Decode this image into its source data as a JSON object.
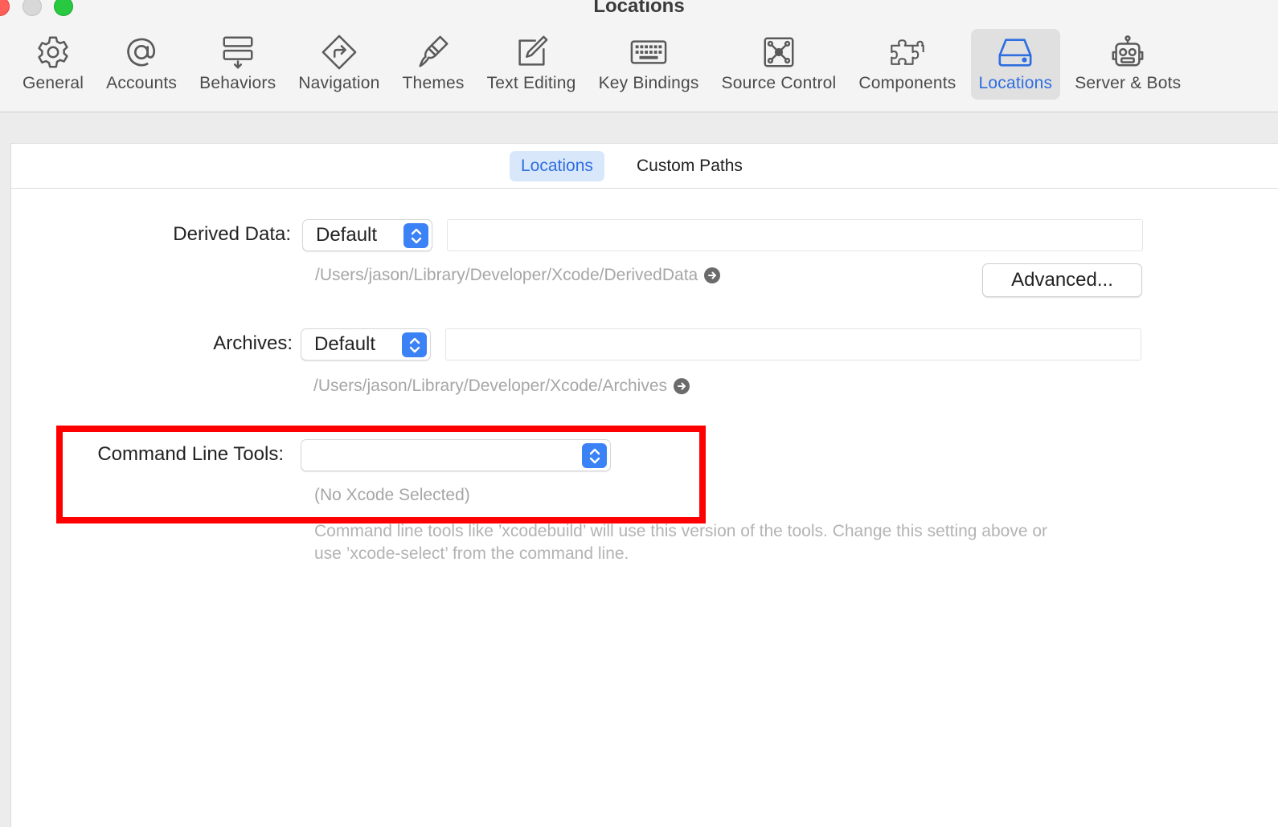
{
  "window": {
    "title": "Locations"
  },
  "toolbar": {
    "items": [
      {
        "label": "General",
        "icon": "gear-icon"
      },
      {
        "label": "Accounts",
        "icon": "at-sign-icon"
      },
      {
        "label": "Behaviors",
        "icon": "behaviors-icon"
      },
      {
        "label": "Navigation",
        "icon": "navigation-sign-icon"
      },
      {
        "label": "Themes",
        "icon": "paintbrush-icon"
      },
      {
        "label": "Text Editing",
        "icon": "pencil-square-icon"
      },
      {
        "label": "Key Bindings",
        "icon": "keyboard-icon"
      },
      {
        "label": "Source Control",
        "icon": "source-control-icon"
      },
      {
        "label": "Components",
        "icon": "puzzle-piece-icon"
      },
      {
        "label": "Locations",
        "icon": "drive-icon",
        "active": true
      },
      {
        "label": "Server & Bots",
        "icon": "robot-icon"
      }
    ],
    "accent_color": "#2f6ee0"
  },
  "tabs": {
    "locations": "Locations",
    "custom_paths": "Custom Paths",
    "active": "Locations"
  },
  "derived_data": {
    "label": "Derived Data:",
    "selected": "Default",
    "path": "/Users/jason/Library/Developer/Xcode/DerivedData",
    "advanced_button": "Advanced..."
  },
  "archives": {
    "label": "Archives:",
    "selected": "Default",
    "path": "/Users/jason/Library/Developer/Xcode/Archives"
  },
  "command_line_tools": {
    "label": "Command Line Tools:",
    "selected": "",
    "status": "(No Xcode Selected)",
    "hint_line1": "Command line tools like ’xcodebuild’ will use this version of the tools. Change this setting above or",
    "hint_line2": "use ’xcode-select’ from the command line."
  },
  "highlight_color": "#ff0000"
}
